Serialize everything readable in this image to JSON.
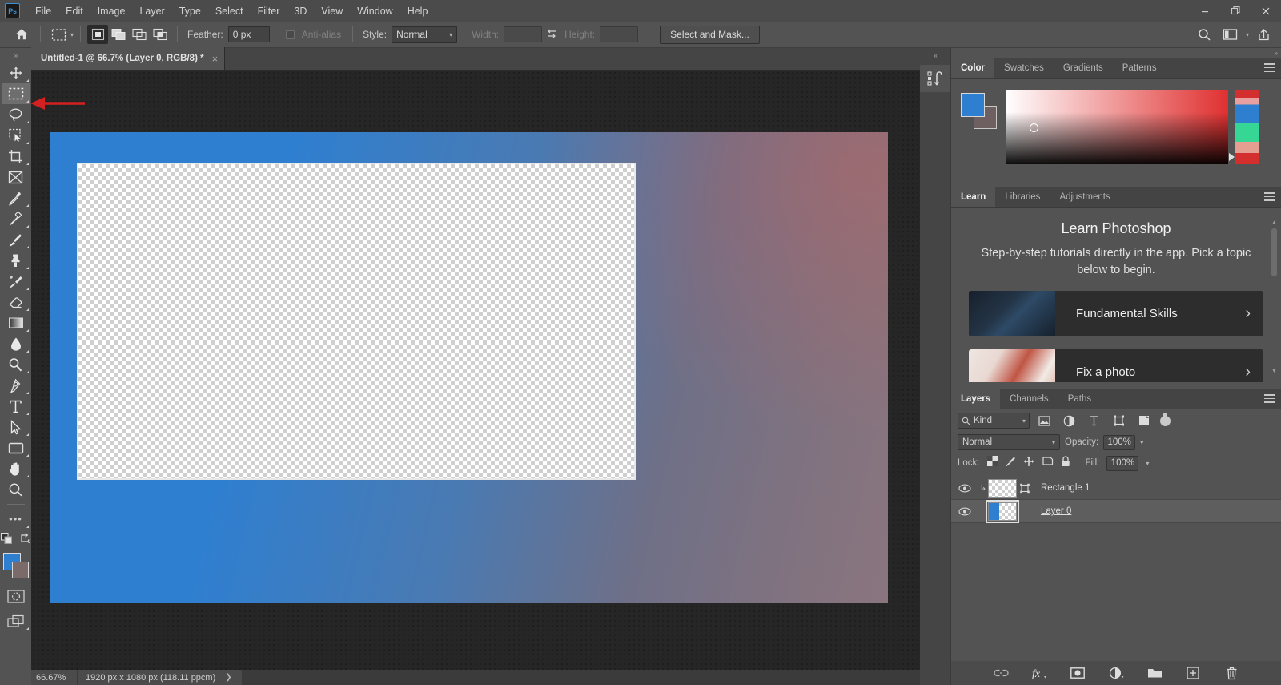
{
  "app": {
    "name": "Adobe Photoshop",
    "logo_text": "Ps",
    "accent": "#3c8fd0",
    "ui_bg": "#535353"
  },
  "menubar": {
    "items": [
      "File",
      "Edit",
      "Image",
      "Layer",
      "Type",
      "Select",
      "Filter",
      "3D",
      "View",
      "Window",
      "Help"
    ],
    "window_controls": [
      "minimize",
      "restore",
      "close"
    ]
  },
  "options_bar": {
    "home_icon": "home-icon",
    "tool_icon": "rectangular-marquee-icon",
    "tool_preset_chevron": "chevron-down-icon",
    "selection_modes": [
      "new-selection",
      "add-to-selection",
      "subtract-from-selection",
      "intersect-with-selection"
    ],
    "active_selection_mode": 0,
    "feather_label": "Feather:",
    "feather_value": "0 px",
    "antialias_label": "Anti-alias",
    "antialias_checked": false,
    "style_label": "Style:",
    "style_value": "Normal",
    "width_label": "Width:",
    "width_value": "",
    "swap_icon": "swap-width-height-icon",
    "height_label": "Height:",
    "height_value": "",
    "select_and_mask_label": "Select and Mask...",
    "right_icons": [
      "search-icon",
      "workspace-icon",
      "chevron-down-icon",
      "share-icon"
    ]
  },
  "toolbar": {
    "collapse_icon": "double-chevron-right-icon",
    "tools": [
      {
        "name": "move-tool",
        "icon": "move-icon",
        "active": false,
        "has_submenu": true
      },
      {
        "name": "rectangular-marquee-tool",
        "icon": "rectangular-marquee-icon",
        "active": true,
        "has_submenu": true
      },
      {
        "name": "lasso-tool",
        "icon": "lasso-icon",
        "active": false,
        "has_submenu": true
      },
      {
        "name": "object-selection-tool",
        "icon": "object-selection-icon",
        "active": false,
        "has_submenu": true
      },
      {
        "name": "crop-tool",
        "icon": "crop-icon",
        "active": false,
        "has_submenu": true
      },
      {
        "name": "frame-tool",
        "icon": "frame-icon",
        "active": false,
        "has_submenu": false
      },
      {
        "name": "eyedropper-tool",
        "icon": "eyedropper-icon",
        "active": false,
        "has_submenu": true
      },
      {
        "name": "spot-healing-brush-tool",
        "icon": "healing-brush-icon",
        "active": false,
        "has_submenu": true
      },
      {
        "name": "brush-tool",
        "icon": "brush-icon",
        "active": false,
        "has_submenu": true
      },
      {
        "name": "clone-stamp-tool",
        "icon": "clone-stamp-icon",
        "active": false,
        "has_submenu": true
      },
      {
        "name": "history-brush-tool",
        "icon": "history-brush-icon",
        "active": false,
        "has_submenu": true
      },
      {
        "name": "eraser-tool",
        "icon": "eraser-icon",
        "active": false,
        "has_submenu": true
      },
      {
        "name": "gradient-tool",
        "icon": "gradient-icon",
        "active": false,
        "has_submenu": true
      },
      {
        "name": "blur-tool",
        "icon": "blur-drop-icon",
        "active": false,
        "has_submenu": true
      },
      {
        "name": "dodge-tool",
        "icon": "dodge-icon",
        "active": false,
        "has_submenu": true
      },
      {
        "name": "pen-tool",
        "icon": "pen-icon",
        "active": false,
        "has_submenu": true
      },
      {
        "name": "type-tool",
        "icon": "type-icon",
        "active": false,
        "has_submenu": true
      },
      {
        "name": "path-selection-tool",
        "icon": "path-selection-arrow-icon",
        "active": false,
        "has_submenu": true
      },
      {
        "name": "rectangle-tool",
        "icon": "rectangle-shape-icon",
        "active": false,
        "has_submenu": true
      },
      {
        "name": "hand-tool",
        "icon": "hand-icon",
        "active": false,
        "has_submenu": true
      },
      {
        "name": "zoom-tool",
        "icon": "zoom-magnifier-icon",
        "active": false,
        "has_submenu": false
      },
      {
        "name": "edit-toolbar",
        "icon": "ellipsis-icon",
        "active": false,
        "has_submenu": true
      }
    ],
    "default_colors_icon": "default-foreground-background-icon",
    "swap_colors_icon": "swap-colors-icon",
    "foreground_color": "#2f7fd0",
    "background_color": "#7a6a6a",
    "quick_mask_icon": "quick-mask-icon",
    "screen_mode_icon": "screen-mode-icon"
  },
  "document_tab": {
    "title": "Untitled-1 @ 66.7% (Layer 0, RGB/8) *",
    "close_icon": "close-icon"
  },
  "canvas": {
    "artboard_gradient_from": "#2f7fd0",
    "artboard_gradient_to": "#8a757e",
    "rectangle_layer_name": "Rectangle 1",
    "annotation": {
      "type": "arrow",
      "points_to": "rectangular-marquee-tool",
      "color": "#d32020"
    }
  },
  "status_bar": {
    "zoom": "66.67%",
    "doc_info": "1920 px x 1080 px (118.11 ppcm)",
    "expand_icon": "chevron-right-icon"
  },
  "dock_strip": {
    "collapse_icon": "double-chevron-left-icon",
    "icons": [
      "history-icon"
    ]
  },
  "color_panel": {
    "tabs": [
      {
        "label": "Color",
        "active": true
      },
      {
        "label": "Swatches",
        "active": false
      },
      {
        "label": "Gradients",
        "active": false
      },
      {
        "label": "Patterns",
        "active": false
      }
    ],
    "menu_icon": "panel-menu-icon",
    "foreground": "#2f7fd0",
    "background": "#6e6060",
    "spectrum_icon": "color-spectrum-field",
    "ramp_icon": "color-ramp"
  },
  "learn_panel": {
    "tabs": [
      {
        "label": "Learn",
        "active": true
      },
      {
        "label": "Libraries",
        "active": false
      },
      {
        "label": "Adjustments",
        "active": false
      }
    ],
    "menu_icon": "panel-menu-icon",
    "title": "Learn Photoshop",
    "subtitle": "Step-by-step tutorials directly in the app. Pick a topic below to begin.",
    "cards": [
      {
        "label": "Fundamental Skills",
        "chevron": "chevron-right-icon"
      },
      {
        "label": "Fix a photo",
        "chevron": "chevron-right-icon"
      }
    ],
    "scroll_up_icon": "caret-up-icon",
    "scroll_down_icon": "caret-down-icon"
  },
  "layers_panel": {
    "tabs": [
      {
        "label": "Layers",
        "active": true
      },
      {
        "label": "Channels",
        "active": false
      },
      {
        "label": "Paths",
        "active": false
      }
    ],
    "menu_icon": "panel-menu-icon",
    "filter": {
      "search_icon": "search-icon",
      "kind_label": "Kind",
      "chevron": "chevron-down-icon",
      "filter_icons": [
        "pixel-layer-filter-icon",
        "adjustment-layer-filter-icon",
        "type-layer-filter-icon",
        "shape-layer-filter-icon",
        "smart-object-filter-icon"
      ],
      "toggle_icon": "filter-power-toggle-icon"
    },
    "blend_mode": "Normal",
    "blend_chevron": "chevron-down-icon",
    "opacity_label": "Opacity:",
    "opacity_value": "100%",
    "lock_label": "Lock:",
    "lock_icons": [
      "lock-transparent-pixels-icon",
      "lock-image-pixels-icon",
      "lock-position-icon",
      "lock-artboard-nesting-icon",
      "lock-all-icon"
    ],
    "fill_label": "Fill:",
    "fill_value": "100%",
    "layers": [
      {
        "name": "Rectangle 1",
        "visible": true,
        "selected": false,
        "eye_icon": "eye-icon",
        "has_clipping_mask": true,
        "clip_icon": "clipping-mask-arrow-icon",
        "vector_mask_icon": "vector-mask-icon",
        "editing": false
      },
      {
        "name": "Layer 0",
        "visible": true,
        "selected": true,
        "eye_icon": "eye-icon",
        "has_clipping_mask": false,
        "clip_icon": "",
        "vector_mask_icon": "",
        "editing": true
      }
    ],
    "footer_icons": [
      "link-layers-icon",
      "layer-styles-fx-icon",
      "add-layer-mask-icon",
      "new-adjustment-layer-icon",
      "new-group-icon",
      "new-layer-icon",
      "delete-layer-icon"
    ]
  }
}
